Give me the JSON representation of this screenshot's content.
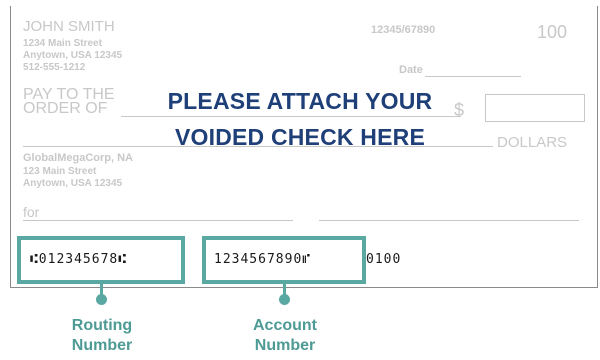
{
  "check": {
    "payer_name": "JOHN SMITH",
    "payer_address1": "1234 Main Street",
    "payer_address2": "Anytown, USA 12345",
    "payer_phone": "512-555-1212",
    "fraction_code": "12345/67890",
    "check_number": "100",
    "date_label": "Date",
    "pay_to_line1": "PAY TO THE",
    "pay_to_line2": "ORDER OF",
    "dollar_sign": "$",
    "dollars_label": "DOLLARS",
    "bank_name": "GlobalMegaCorp, NA",
    "bank_address1": "123 Main Street",
    "bank_address2": "Anytown, USA 12345",
    "memo_label": "for",
    "micr_routing": "⑆012345678⑆",
    "micr_account": "1234567890⑈",
    "micr_check_number": "0100"
  },
  "overlay": {
    "line1": "PLEASE ATTACH YOUR",
    "line2": "VOIDED CHECK HERE"
  },
  "callouts": {
    "routing_line1": "Routing",
    "routing_line2": "Number",
    "account_line1": "Account",
    "account_line2": "Number"
  },
  "colors": {
    "highlight": "#5aa8a2",
    "overlay_text": "#1f3f78"
  }
}
